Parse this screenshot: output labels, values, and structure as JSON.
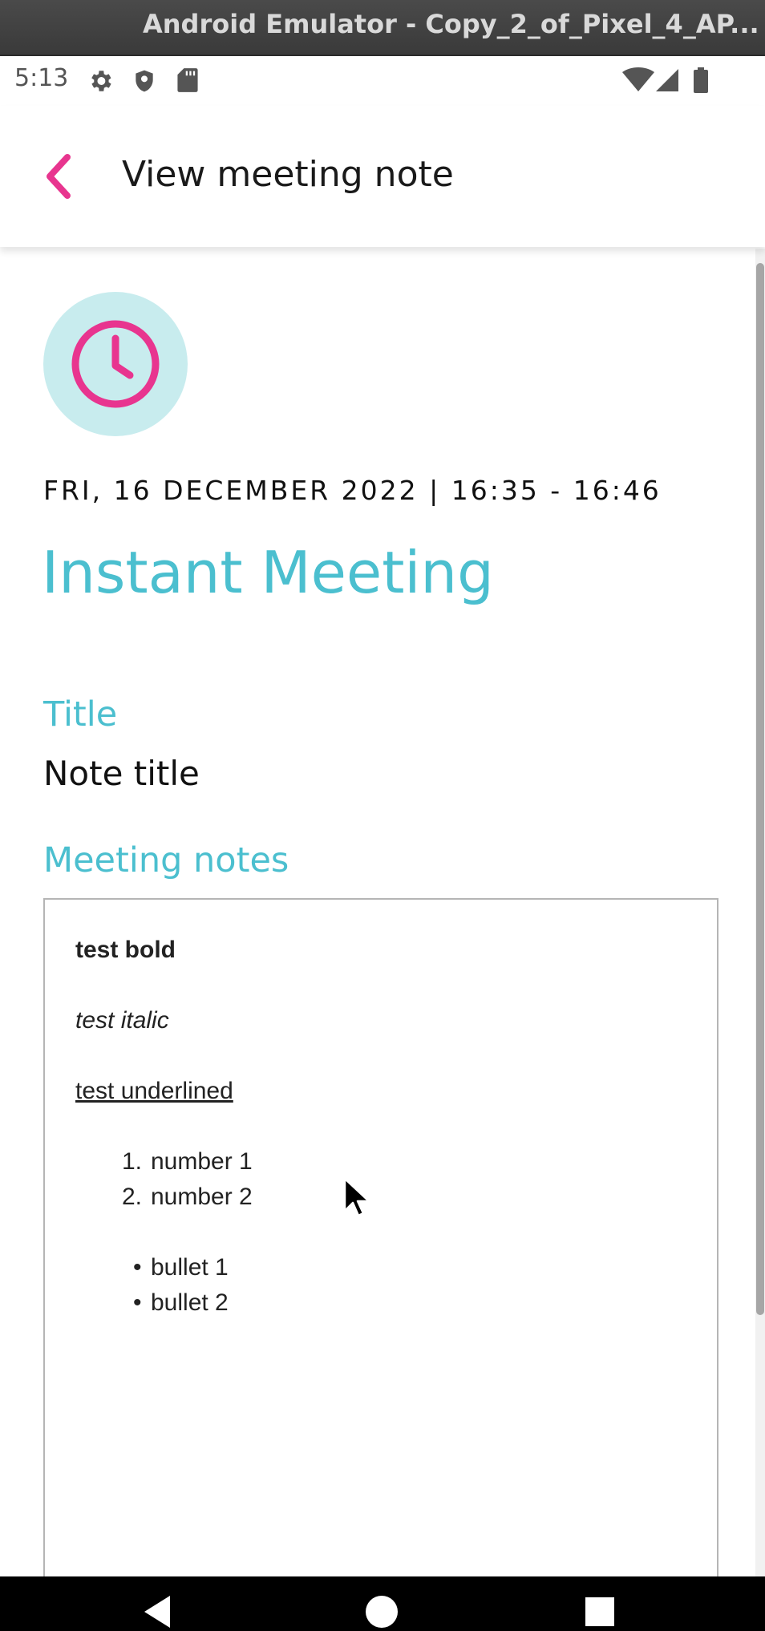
{
  "window": {
    "title": "Android Emulator - Copy_2_of_Pixel_4_AP..."
  },
  "status_bar": {
    "time": "5:13",
    "left_icons": [
      "gear-icon",
      "shield-icon",
      "sd-card-icon"
    ],
    "right_icons": [
      "wifi-icon",
      "cell-signal-icon",
      "battery-icon"
    ]
  },
  "app_bar": {
    "title": "View meeting note",
    "back_icon": "chevron-left-icon"
  },
  "meeting": {
    "icon": "clock-icon",
    "datetime": "FRI, 16 DECEMBER 2022 | 16:35 - 16:46",
    "name": "Instant Meeting"
  },
  "fields": {
    "title_label": "Title",
    "title_value": "Note title",
    "notes_label": "Meeting notes"
  },
  "notes": {
    "bold": "test bold",
    "italic": "test italic",
    "underlined": "test underlined",
    "numbered_list": [
      {
        "marker": "1.",
        "text": "number 1"
      },
      {
        "marker": "2.",
        "text": "number 2"
      }
    ],
    "bullet_list": [
      {
        "marker": "•",
        "text": "bullet 1"
      },
      {
        "marker": "•",
        "text": "bullet 2"
      }
    ]
  },
  "nav_bar": {
    "buttons": [
      "back-triangle-icon",
      "home-circle-icon",
      "recents-square-icon"
    ]
  },
  "colors": {
    "accent_pink": "#e8358f",
    "accent_teal": "#4bbfcf",
    "avatar_bg": "#c8ecee"
  }
}
